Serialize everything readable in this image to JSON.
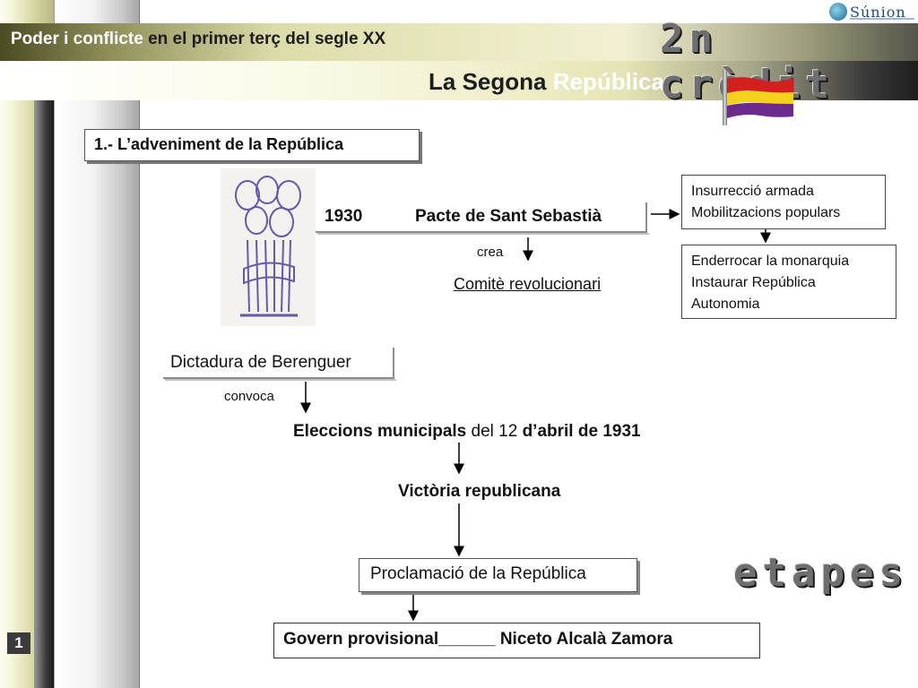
{
  "header": {
    "title_light": "Poder i conflicte",
    "title_dark": "en el primer terç del segle XX",
    "section_dark": "La Segona",
    "section_light": "República",
    "logo_text": "Súnion",
    "deco_top": "2n crèdit",
    "deco_bottom": "etapes"
  },
  "heading": "1.- L’adveniment de la República",
  "pacte": {
    "year": "1930",
    "name": "Pacte de Sant Sebastià"
  },
  "crea": "crea",
  "comite": "Comitè revolucionari",
  "box_goals": [
    "Insurrecció armada",
    "Mobilitzacions populars"
  ],
  "box_aims": [
    "Enderrocar la monarquia",
    "Instaurar República",
    "Autonomia"
  ],
  "dictadura": "Dictadura de Berenguer",
  "convoca": "convoca",
  "eleccions": {
    "part1": "Eleccions municipals",
    "part2": " del 12 ",
    "part3": "d’abril de 1931"
  },
  "victoria": "Victòria republicana",
  "proclamacio": "Proclamació de la República",
  "govern": "Govern provisional______ Niceto Alcalà Zamora",
  "slide_number": "1",
  "colors": {
    "flag_red": "#d41f1f",
    "flag_yellow": "#f2d21a",
    "flag_purple": "#6b2a8c",
    "caricature": "#6a58a8"
  }
}
